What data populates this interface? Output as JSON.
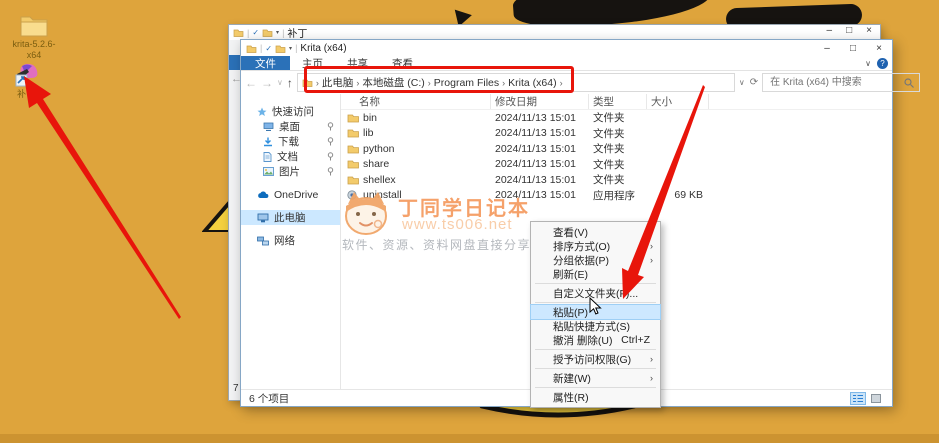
{
  "colors": {
    "wallpaper": "#dea43c",
    "annotation_red": "#e8150b",
    "accent_blue": "#2b71b8",
    "menu_highlight": "#cde8ff"
  },
  "icons": {
    "back_arrow": "←",
    "forward_arrow": "→",
    "up_arrow": "↑",
    "dropdown": "∨",
    "refresh": "⟳",
    "crumb_chevron": "›",
    "sort_caret": "ˆ",
    "submenu_chevron": "›",
    "toolbar_check": "✓",
    "toolbar_caret": "▾",
    "pipe": "|",
    "help": "?",
    "minimize": "–",
    "maximize": "□",
    "close": "×"
  },
  "desktop": {
    "icon1_label_line1": "krita-5.2.6-",
    "icon1_label_line2": "x64",
    "icon2_label": "补丁"
  },
  "back_window": {
    "title": "补丁",
    "status_fragment": "7"
  },
  "explorer": {
    "title": "Krita (x64)",
    "tabs": [
      {
        "label": "文件"
      },
      {
        "label": "主页"
      },
      {
        "label": "共享"
      },
      {
        "label": "查看"
      }
    ],
    "breadcrumb": {
      "crumbs": [
        {
          "label": "此电脑"
        },
        {
          "label": "本地磁盘 (C:)"
        },
        {
          "label": "Program Files"
        },
        {
          "label": "Krita (x64)"
        }
      ]
    },
    "search_placeholder": "在 Krita (x64) 中搜索",
    "sidebar": [
      {
        "label": "快速访问"
      },
      {
        "label": "桌面",
        "pinned": true
      },
      {
        "label": "下载",
        "pinned": true
      },
      {
        "label": "文档",
        "pinned": true
      },
      {
        "label": "图片",
        "pinned": true
      },
      {
        "label": "OneDrive"
      },
      {
        "label": "此电脑",
        "selected": true
      },
      {
        "label": "网络"
      }
    ],
    "columns": {
      "name": "名称",
      "date": "修改日期",
      "type": "类型",
      "size": "大小"
    },
    "files": [
      {
        "name": "bin",
        "date": "2024/11/13 15:01",
        "type": "文件夹",
        "size": ""
      },
      {
        "name": "lib",
        "date": "2024/11/13 15:01",
        "type": "文件夹",
        "size": ""
      },
      {
        "name": "python",
        "date": "2024/11/13 15:01",
        "type": "文件夹",
        "size": ""
      },
      {
        "name": "share",
        "date": "2024/11/13 15:01",
        "type": "文件夹",
        "size": ""
      },
      {
        "name": "shellex",
        "date": "2024/11/13 15:01",
        "type": "文件夹",
        "size": ""
      },
      {
        "name": "uninstall",
        "date": "2024/11/13 15:01",
        "type": "应用程序",
        "size": "69 KB"
      }
    ],
    "status": "6 个项目"
  },
  "context_menu": {
    "items": [
      {
        "label": "查看(V)",
        "submenu": true
      },
      {
        "label": "排序方式(O)",
        "submenu": true
      },
      {
        "label": "分组依据(P)",
        "submenu": true
      },
      {
        "label": "刷新(E)"
      },
      {
        "label": "自定义文件夹(F)..."
      },
      {
        "label": "粘贴(P)",
        "highlighted": true
      },
      {
        "label": "粘贴快捷方式(S)"
      },
      {
        "label": "撤消 删除(U)",
        "shortcut": "Ctrl+Z"
      },
      {
        "label": "授予访问权限(G)",
        "submenu": true
      },
      {
        "label": "新建(W)",
        "submenu": true
      },
      {
        "label": "属性(R)"
      }
    ]
  },
  "watermark": {
    "title": "丁同学日记本",
    "url": "www.ts006.net",
    "line": "软件、资源、资料网盘直接分享下载"
  }
}
